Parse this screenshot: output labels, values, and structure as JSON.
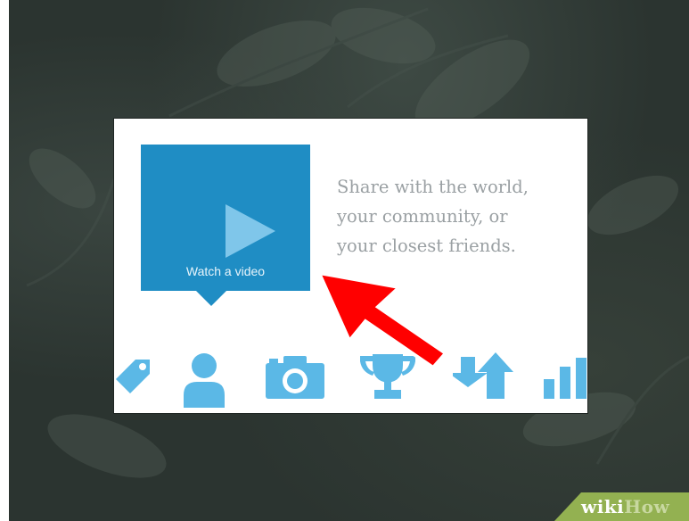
{
  "card": {
    "video_button_label": "Watch a video",
    "tagline": "Share with the world,\nyour community, or\nyour closest friends."
  },
  "icons": [
    "tag-icon",
    "person-icon",
    "camera-icon",
    "trophy-icon",
    "swap-arrows-icon",
    "bar-chart-icon"
  ],
  "annotation": {
    "arrow_color": "#ff0000"
  },
  "watermark": {
    "part1": "wiki",
    "part2": "How"
  },
  "colors": {
    "accent": "#1f8dc4",
    "icon": "#5bb8e6",
    "backdrop": "#2b3430",
    "tagline": "#9aa0a3"
  }
}
